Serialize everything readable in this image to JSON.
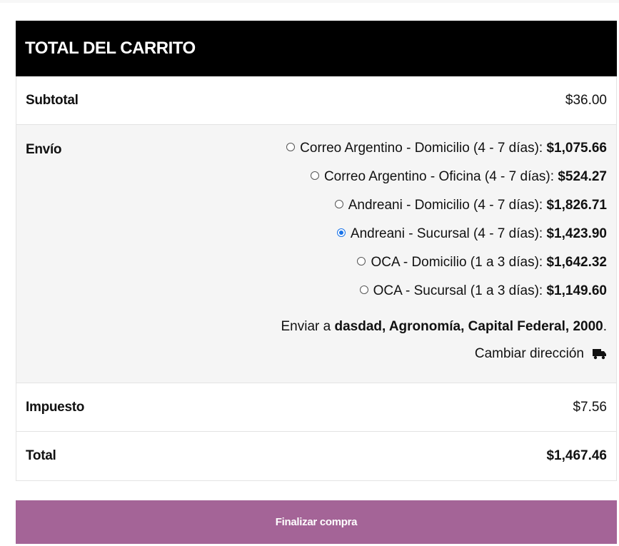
{
  "cart_totals": {
    "title": "TOTAL DEL CARRITO",
    "subtotal": {
      "label": "Subtotal",
      "value": "$36.00"
    },
    "shipping": {
      "label": "Envío",
      "methods": [
        {
          "name": "Correo Argentino - Domicilio (4 - 7 días):",
          "price": "$1,075.66",
          "selected": false
        },
        {
          "name": "Correo Argentino - Oficina (4 - 7 días):",
          "price": "$524.27",
          "selected": false
        },
        {
          "name": "Andreani - Domicilio (4 - 7 días):",
          "price": "$1,826.71",
          "selected": false
        },
        {
          "name": "Andreani - Sucursal (4 - 7 días):",
          "price": "$1,423.90",
          "selected": true
        },
        {
          "name": "OCA - Domicilio (1 a 3 días):",
          "price": "$1,642.32",
          "selected": false
        },
        {
          "name": "OCA - Sucursal (1 a 3 días):",
          "price": "$1,149.60",
          "selected": false
        }
      ],
      "destination_prefix": "Enviar a",
      "destination_address": "dasdad, Agronomía, Capital Federal, 2000",
      "destination_suffix": ".",
      "change_address": "Cambiar dirección",
      "change_icon": "truck-icon"
    },
    "tax": {
      "label": "Impuesto",
      "value": "$7.56"
    },
    "total": {
      "label": "Total",
      "value": "$1,467.46"
    }
  },
  "checkout": {
    "button_label": "Finalizar compra"
  },
  "colors": {
    "header_bg": "#000000",
    "button_bg": "#a46497",
    "shipping_bg": "#f5f5f5",
    "radio_selected": "#1a73e8"
  }
}
